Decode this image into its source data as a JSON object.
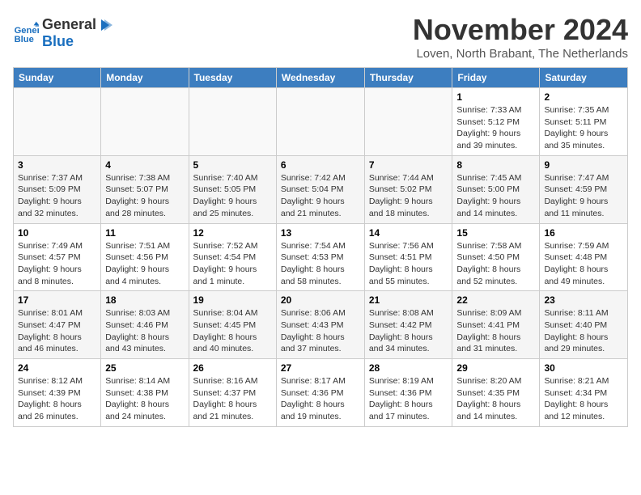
{
  "logo": {
    "line1": "General",
    "line2": "Blue"
  },
  "title": "November 2024",
  "location": "Loven, North Brabant, The Netherlands",
  "headers": [
    "Sunday",
    "Monday",
    "Tuesday",
    "Wednesday",
    "Thursday",
    "Friday",
    "Saturday"
  ],
  "weeks": [
    [
      {
        "day": "",
        "info": ""
      },
      {
        "day": "",
        "info": ""
      },
      {
        "day": "",
        "info": ""
      },
      {
        "day": "",
        "info": ""
      },
      {
        "day": "",
        "info": ""
      },
      {
        "day": "1",
        "info": "Sunrise: 7:33 AM\nSunset: 5:12 PM\nDaylight: 9 hours and 39 minutes."
      },
      {
        "day": "2",
        "info": "Sunrise: 7:35 AM\nSunset: 5:11 PM\nDaylight: 9 hours and 35 minutes."
      }
    ],
    [
      {
        "day": "3",
        "info": "Sunrise: 7:37 AM\nSunset: 5:09 PM\nDaylight: 9 hours and 32 minutes."
      },
      {
        "day": "4",
        "info": "Sunrise: 7:38 AM\nSunset: 5:07 PM\nDaylight: 9 hours and 28 minutes."
      },
      {
        "day": "5",
        "info": "Sunrise: 7:40 AM\nSunset: 5:05 PM\nDaylight: 9 hours and 25 minutes."
      },
      {
        "day": "6",
        "info": "Sunrise: 7:42 AM\nSunset: 5:04 PM\nDaylight: 9 hours and 21 minutes."
      },
      {
        "day": "7",
        "info": "Sunrise: 7:44 AM\nSunset: 5:02 PM\nDaylight: 9 hours and 18 minutes."
      },
      {
        "day": "8",
        "info": "Sunrise: 7:45 AM\nSunset: 5:00 PM\nDaylight: 9 hours and 14 minutes."
      },
      {
        "day": "9",
        "info": "Sunrise: 7:47 AM\nSunset: 4:59 PM\nDaylight: 9 hours and 11 minutes."
      }
    ],
    [
      {
        "day": "10",
        "info": "Sunrise: 7:49 AM\nSunset: 4:57 PM\nDaylight: 9 hours and 8 minutes."
      },
      {
        "day": "11",
        "info": "Sunrise: 7:51 AM\nSunset: 4:56 PM\nDaylight: 9 hours and 4 minutes."
      },
      {
        "day": "12",
        "info": "Sunrise: 7:52 AM\nSunset: 4:54 PM\nDaylight: 9 hours and 1 minute."
      },
      {
        "day": "13",
        "info": "Sunrise: 7:54 AM\nSunset: 4:53 PM\nDaylight: 8 hours and 58 minutes."
      },
      {
        "day": "14",
        "info": "Sunrise: 7:56 AM\nSunset: 4:51 PM\nDaylight: 8 hours and 55 minutes."
      },
      {
        "day": "15",
        "info": "Sunrise: 7:58 AM\nSunset: 4:50 PM\nDaylight: 8 hours and 52 minutes."
      },
      {
        "day": "16",
        "info": "Sunrise: 7:59 AM\nSunset: 4:48 PM\nDaylight: 8 hours and 49 minutes."
      }
    ],
    [
      {
        "day": "17",
        "info": "Sunrise: 8:01 AM\nSunset: 4:47 PM\nDaylight: 8 hours and 46 minutes."
      },
      {
        "day": "18",
        "info": "Sunrise: 8:03 AM\nSunset: 4:46 PM\nDaylight: 8 hours and 43 minutes."
      },
      {
        "day": "19",
        "info": "Sunrise: 8:04 AM\nSunset: 4:45 PM\nDaylight: 8 hours and 40 minutes."
      },
      {
        "day": "20",
        "info": "Sunrise: 8:06 AM\nSunset: 4:43 PM\nDaylight: 8 hours and 37 minutes."
      },
      {
        "day": "21",
        "info": "Sunrise: 8:08 AM\nSunset: 4:42 PM\nDaylight: 8 hours and 34 minutes."
      },
      {
        "day": "22",
        "info": "Sunrise: 8:09 AM\nSunset: 4:41 PM\nDaylight: 8 hours and 31 minutes."
      },
      {
        "day": "23",
        "info": "Sunrise: 8:11 AM\nSunset: 4:40 PM\nDaylight: 8 hours and 29 minutes."
      }
    ],
    [
      {
        "day": "24",
        "info": "Sunrise: 8:12 AM\nSunset: 4:39 PM\nDaylight: 8 hours and 26 minutes."
      },
      {
        "day": "25",
        "info": "Sunrise: 8:14 AM\nSunset: 4:38 PM\nDaylight: 8 hours and 24 minutes."
      },
      {
        "day": "26",
        "info": "Sunrise: 8:16 AM\nSunset: 4:37 PM\nDaylight: 8 hours and 21 minutes."
      },
      {
        "day": "27",
        "info": "Sunrise: 8:17 AM\nSunset: 4:36 PM\nDaylight: 8 hours and 19 minutes."
      },
      {
        "day": "28",
        "info": "Sunrise: 8:19 AM\nSunset: 4:36 PM\nDaylight: 8 hours and 17 minutes."
      },
      {
        "day": "29",
        "info": "Sunrise: 8:20 AM\nSunset: 4:35 PM\nDaylight: 8 hours and 14 minutes."
      },
      {
        "day": "30",
        "info": "Sunrise: 8:21 AM\nSunset: 4:34 PM\nDaylight: 8 hours and 12 minutes."
      }
    ]
  ]
}
